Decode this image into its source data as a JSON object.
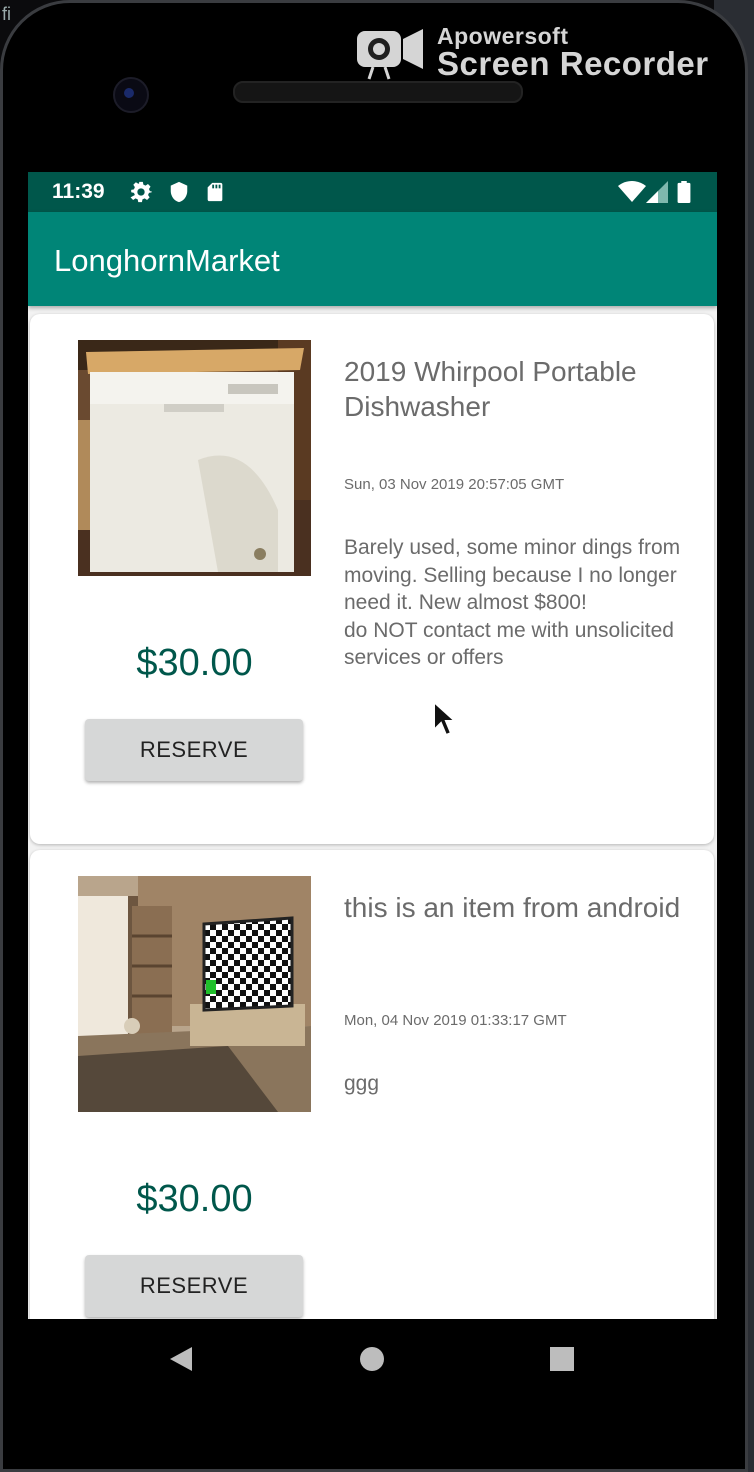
{
  "desktop": {
    "corner_text": "fi"
  },
  "watermark": {
    "line1": "Apowersoft",
    "line2": "Screen Recorder"
  },
  "status_bar": {
    "time": "11:39",
    "icons": [
      "gear-icon",
      "shield-icon",
      "sd-card-icon",
      "wifi-icon",
      "signal-icon",
      "battery-icon"
    ]
  },
  "app_bar": {
    "title": "LonghornMarket"
  },
  "listings": [
    {
      "title": "2019 Whirpool Portable Dishwasher",
      "date": "Sun, 03 Nov 2019 20:57:05 GMT",
      "description": "Barely used, some minor dings from moving. Selling because I no longer need it. New almost $800!\ndo NOT contact me with unsolicited services or offers",
      "price": "$30.00",
      "button_label": "RESERVE"
    },
    {
      "title": "this is an item from android",
      "date": "Mon, 04 Nov 2019 01:33:17 GMT",
      "description": "ggg",
      "price": "$30.00",
      "button_label": "RESERVE"
    }
  ],
  "nav_bar": {
    "buttons": [
      "back-icon",
      "home-icon",
      "recents-icon"
    ]
  },
  "colors": {
    "status_bar": "#00574b",
    "app_bar": "#008577",
    "price": "#00574b",
    "button": "#d6d7d7"
  }
}
